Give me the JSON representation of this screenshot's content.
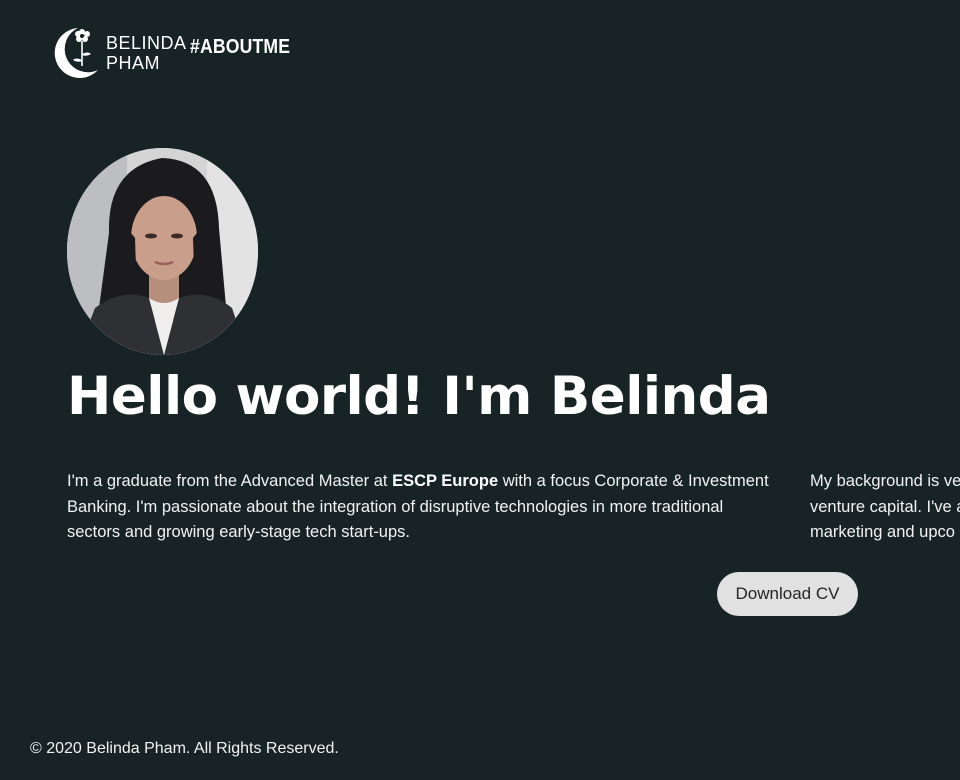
{
  "header": {
    "logo_line1": "BELINDA",
    "logo_line2": "PHAM",
    "tag": "#ABOUTME"
  },
  "hero": {
    "title": "Hello world! I'm Belinda"
  },
  "intro": {
    "p1_part1": "I'm a graduate from the Advanced Master at ",
    "p1_bold": "ESCP Europe",
    "p1_part2": " with a focus Corporate & Investment Banking. I'm passionate about the integration of disruptive technologies in more traditional sectors and growing early-stage tech start-ups.",
    "p2_line1": "My background is ve",
    "p2_line2": "venture capital. I've a",
    "p2_line3": "marketing and upco"
  },
  "actions": {
    "download_cv": "Download CV"
  },
  "footer": {
    "copyright": "© 2020 Belinda Pham. All Rights Reserved."
  },
  "colors": {
    "background": "#182326",
    "text": "#ffffff",
    "button_bg": "#e1e1e1",
    "button_text": "#252525"
  }
}
